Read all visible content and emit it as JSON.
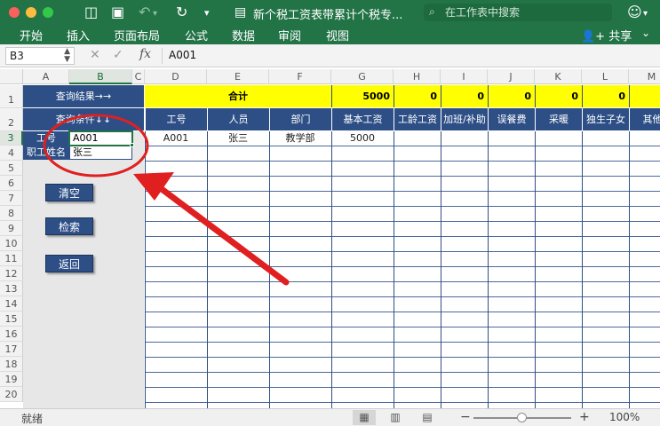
{
  "window": {
    "title": "新个税工资表带累计个税专...",
    "search_placeholder": "在工作表中搜索"
  },
  "ribbon": {
    "tabs": [
      "开始",
      "插入",
      "页面布局",
      "公式",
      "数据",
      "审阅",
      "视图"
    ],
    "share_label": "共享"
  },
  "formula_bar": {
    "name_box": "B3",
    "fx_label": "fx",
    "value": "A001"
  },
  "columns": [
    "A",
    "B",
    "C",
    "D",
    "E",
    "F",
    "G",
    "H",
    "I",
    "J",
    "K",
    "L",
    "M"
  ],
  "rows": [
    "1",
    "2",
    "3",
    "4",
    "5",
    "6",
    "7",
    "8",
    "9",
    "10",
    "11",
    "12",
    "13",
    "14",
    "15",
    "16",
    "17",
    "18",
    "19",
    "20"
  ],
  "panel": {
    "query_result": "查询结果→→",
    "query_condition": "查询条件↓↓",
    "label_id": "工号",
    "label_name": "职工姓名",
    "input_id": "A001",
    "input_name": "张三",
    "buttons": {
      "clear": "清空",
      "search": "检索",
      "back": "返回"
    }
  },
  "table": {
    "total_label": "合计",
    "totals": [
      "5000",
      "0",
      "0",
      "0",
      "0",
      "0"
    ],
    "headers": [
      "工号",
      "人员",
      "部门",
      "基本工资",
      "工龄工资",
      "加班/补助",
      "误餐费",
      "采暖",
      "独生子女",
      "其他"
    ],
    "row": [
      "A001",
      "张三",
      "教学部",
      "5000"
    ]
  },
  "status": {
    "ready": "就绪",
    "zoom_percent": "100%",
    "zoom_level": 1.0
  },
  "colors": {
    "excel_green": "#227447",
    "navy": "#2d4f86",
    "yellow": "#ffff00",
    "annotation_red": "#e02020"
  }
}
